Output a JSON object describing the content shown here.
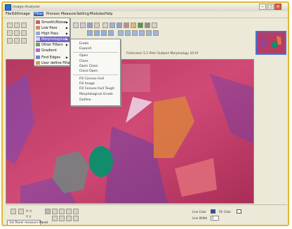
{
  "window": {
    "title": "Image Analyzer"
  },
  "menu": {
    "items": [
      "File",
      "Edit",
      "Image",
      "Filter",
      "Process",
      "Measure",
      "Setting",
      "Modules",
      "Help"
    ],
    "active": "Filter"
  },
  "filter_menu": {
    "items": [
      {
        "label": "Smooth/Noise",
        "has_submenu": true
      },
      {
        "label": "Low Pass",
        "has_submenu": true
      },
      {
        "label": "High Pass",
        "has_submenu": true
      },
      {
        "label": "Morphological",
        "has_submenu": true,
        "highlighted": true
      },
      {
        "label": "Other Filters",
        "has_submenu": true
      },
      {
        "label": "Gradient",
        "has_submenu": false
      },
      {
        "label": "Find Edges",
        "has_submenu": true
      },
      {
        "label": "User define Filter",
        "has_submenu": false
      }
    ]
  },
  "morph_submenu": {
    "items": [
      "Erode",
      "Expand",
      "Open",
      "Close",
      "Open Close",
      "Close Open",
      "Fill Convex Hull",
      "Fill Image",
      "Fill Convex Hull Tough",
      "Morphological Grade",
      "Outline"
    ]
  },
  "image_panel": {
    "caption": "Fullscreen 5.1 Petri Subject Morphology 10.tif"
  },
  "bottom": {
    "status_tab": "1st Panel measure Panel",
    "xy_labels": [
      "X: V",
      "Y: V"
    ],
    "color_label": "Line Color",
    "fill_label": "Fill Color",
    "line_width_label": "Line Width",
    "line_width_value": "5"
  },
  "colors": {
    "accent_blue": "#2f5fbf",
    "menu_highlight": "#6f63c8",
    "frame": "#e1b92f",
    "tissue_pink": "#c43b67"
  }
}
